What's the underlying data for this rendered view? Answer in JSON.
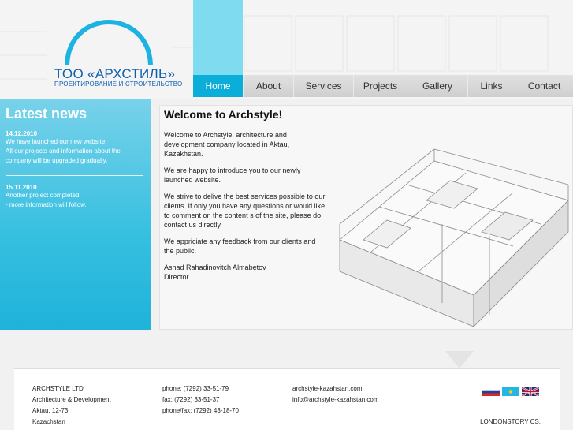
{
  "logo": {
    "title": "ТОО «АРХСТИЛЬ»",
    "subtitle": "ПРОЕКТИРОВАНИЕ И СТРОИТЕЛЬСТВО"
  },
  "nav": [
    {
      "label": "Home",
      "active": true
    },
    {
      "label": "About",
      "active": false
    },
    {
      "label": "Services",
      "active": false
    },
    {
      "label": "Projects",
      "active": false
    },
    {
      "label": "Gallery",
      "active": false
    },
    {
      "label": "Links",
      "active": false
    },
    {
      "label": "Contact",
      "active": false
    }
  ],
  "news": {
    "heading": "Latest news",
    "items": [
      {
        "date": "14.12.2010",
        "lines": [
          "We have launched our new website.",
          "All our projects and information about the",
          "company will be upgraded gradually."
        ]
      },
      {
        "date": "15.11.2010",
        "lines": [
          "Another project completed",
          "- more information will follow."
        ]
      }
    ]
  },
  "welcome": {
    "title": "Welcome to Archstyle!",
    "paragraphs": [
      "Welcome to Archstyle, architecture and development company located in Aktau, Kazakhstan.",
      "We are happy to introduce you to our newly launched website.",
      "We strive to delive the best services possible to our clients. If only you have any questions or would like to comment on the content s of the site, please do contact us directly.",
      "We appriciate any feedback from our clients and the public."
    ],
    "signature_name": "Ashad Rahadinovitch Almabetov",
    "signature_title": "Director"
  },
  "footer": {
    "company": [
      "ARCHSTYLE LTD",
      "Architecture & Development",
      "Aktau, 12-73",
      "Kazachstan"
    ],
    "phones": [
      "phone: (7292) 33-51-79",
      "fax: (7292) 33-51-37",
      "phone/fax: (7292) 43-18-70"
    ],
    "web": [
      "archstyle-kazahstan.com",
      "info@archstyle-kazahstan.com"
    ],
    "credit": "LONDONSTORY CS.",
    "flags": [
      "russian-flag",
      "kazakh-flag",
      "uk-flag"
    ]
  },
  "colors": {
    "accent": "#0aaed8",
    "logo_blue": "#0f5fae",
    "strip": "#7fdcf0"
  }
}
